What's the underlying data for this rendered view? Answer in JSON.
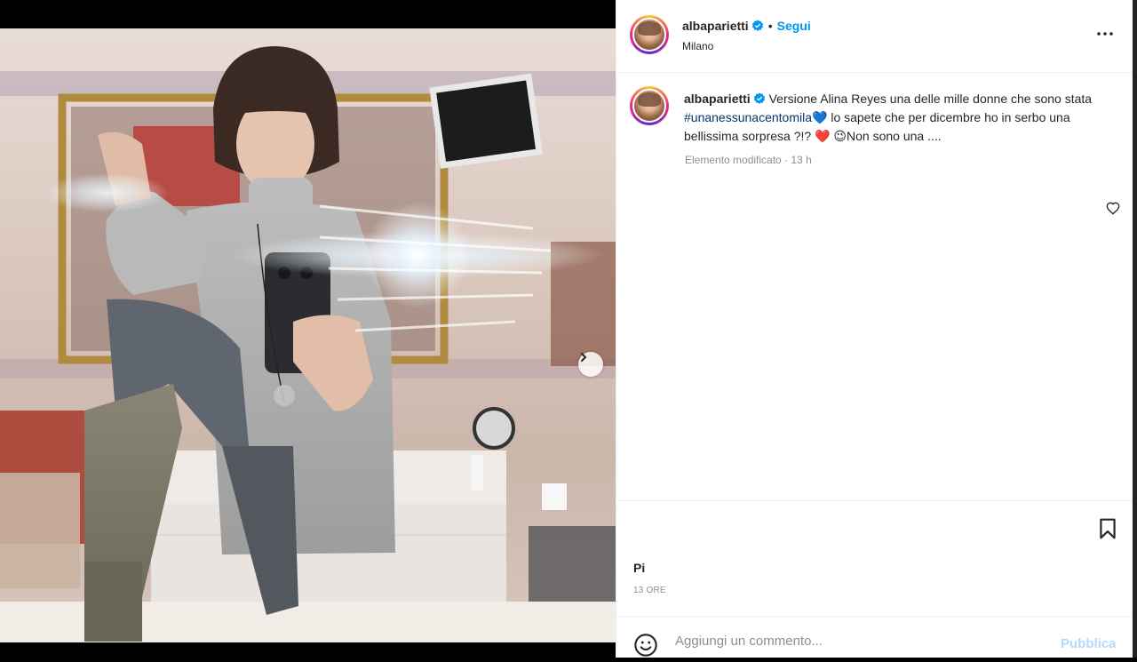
{
  "post": {
    "username": "albaparietti",
    "follow_label": "Segui",
    "separator": "•",
    "location": "Milano",
    "caption": {
      "username": "albaparietti",
      "text_before": "Versione Alina Reyes una delle mille donne che sono stata ",
      "hashtag": "#unanessunacentomila",
      "text_after": " lo sapete che per dicembre ho in serbo una bellissima sorpresa ?!? ",
      "text_end": "Non sono una ....",
      "emoji_heart_blue": "💙",
      "emoji_heart_red": "❤️",
      "emoji_wink": "😉"
    },
    "meta": "Elemento modificato · 13 h",
    "likes_text": "Pi",
    "time_text": "13 ORE"
  },
  "comment": {
    "placeholder": "Aggiungi un commento...",
    "publish_label": "Pubblica"
  },
  "carousel": {
    "slide_count": 2,
    "active_index": 0
  },
  "icons": {
    "verified": "verified-badge-icon",
    "more": "more-options-icon",
    "heart": "heart-icon",
    "bookmark": "bookmark-icon",
    "emoji": "emoji-icon",
    "next": "chevron-right-icon"
  },
  "colors": {
    "accent": "#0095f6",
    "hashtag": "#00376b",
    "muted": "#8e8e8e",
    "publish_disabled": "#b3dbff"
  }
}
